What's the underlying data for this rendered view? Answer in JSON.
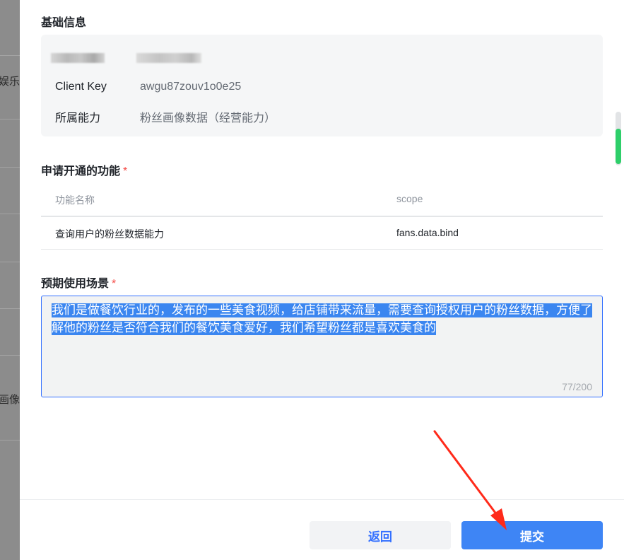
{
  "background": {
    "text_1": "娱乐t",
    "text_2": "画像数"
  },
  "basic_info": {
    "title": "基础信息",
    "client_key_label": "Client Key",
    "client_key_value": "awgu87zouv1o0e25",
    "capability_label": "所属能力",
    "capability_value": "粉丝画像数据（经营能力）"
  },
  "functions": {
    "title": "申请开通的功能",
    "required_mark": "*",
    "columns": [
      "功能名称",
      "scope"
    ],
    "rows": [
      {
        "name": "查询用户的粉丝数据能力",
        "scope": "fans.data.bind"
      }
    ]
  },
  "scenario": {
    "title": "预期使用场景",
    "required_mark": "*",
    "value": "我们是做餐饮行业的，发布的一些美食视频，给店铺带来流量，需要查询授权用户的粉丝数据，方便了解他的粉丝是否符合我们的餐饮美食爱好，我们希望粉丝都是喜欢美食的",
    "counter": "77/200"
  },
  "footer": {
    "back_label": "返回",
    "submit_label": "提交"
  },
  "colors": {
    "primary": "#3370ff",
    "required": "#f54a45",
    "selection": "#3b86f0",
    "scroll_thumb": "#2ecf6a",
    "arrow": "#ff2a1a"
  }
}
